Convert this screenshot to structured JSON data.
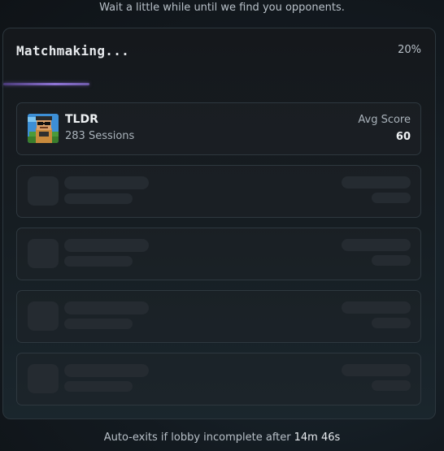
{
  "header": {
    "subtitle": "Wait a little while until we find you opponents."
  },
  "panel": {
    "title": "Matchmaking...",
    "progress_label": "20%",
    "progress_fraction": 0.2,
    "accent_color": "#8f74d6"
  },
  "player": {
    "name": "TLDR",
    "sessions": "283 Sessions",
    "avg_label": "Avg Score",
    "avg_value": "60",
    "avatar_icon": "pixel-avatar-icon"
  },
  "placeholders": {
    "count": 4
  },
  "footer": {
    "text": "Auto-exits if lobby incomplete after",
    "timer": "14m 46s"
  }
}
